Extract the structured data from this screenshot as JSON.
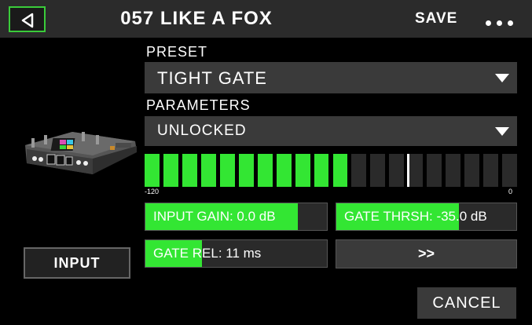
{
  "header": {
    "title": "057 LIKE A FOX",
    "save_label": "SAVE",
    "back_icon": "back-triangle-icon",
    "more_icon": "more-dots-icon"
  },
  "preset": {
    "label": "PRESET",
    "value": "TIGHT GATE"
  },
  "parameters": {
    "label": "PARAMETERS",
    "value": "UNLOCKED"
  },
  "meter": {
    "min_label": "-120",
    "max_label": "0",
    "total_segments": 20,
    "lit_segments": 11,
    "level_fraction": 0.55,
    "threshold_fraction": 0.705,
    "lit_color": "#33e633",
    "unlit_color": "#2a2a2a"
  },
  "params": {
    "input_gain": {
      "text": "INPUT GAIN: 0.0 dB",
      "fill_fraction": 0.84
    },
    "gate_thresh": {
      "text": "GATE THRSH: -35.0 dB",
      "fill_fraction": 0.68
    },
    "gate_rel": {
      "text": "GATE REL: 11 ms",
      "fill_fraction": 0.31
    }
  },
  "next_button": {
    "label": ">>"
  },
  "input_button": {
    "label": "INPUT"
  },
  "cancel_button": {
    "label": "CANCEL"
  },
  "colors": {
    "accent": "#33e633",
    "title_bar": "#2b2b2b",
    "dropdown_bg": "#3a3a3a"
  }
}
